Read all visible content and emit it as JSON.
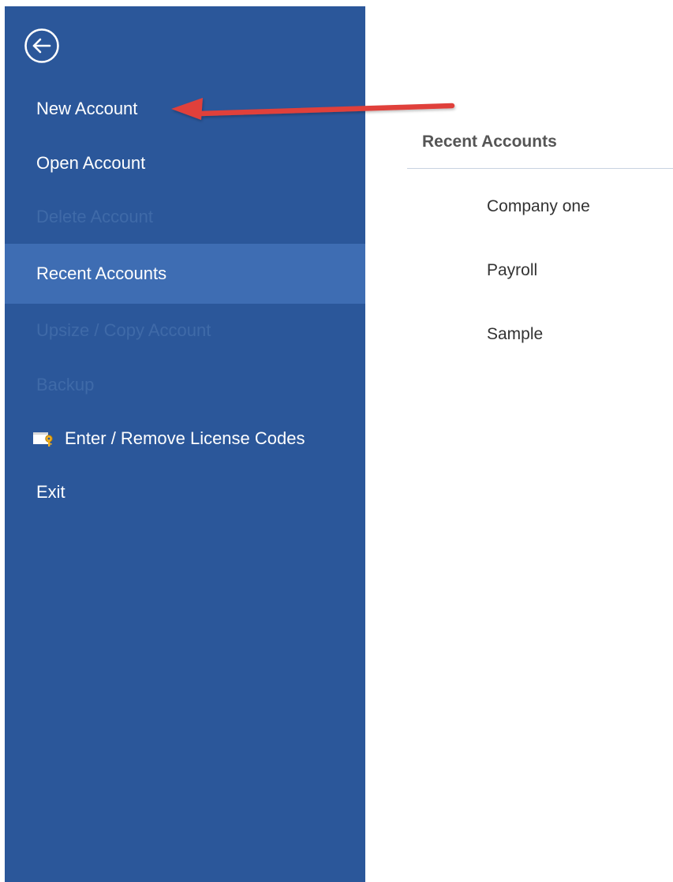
{
  "colors": {
    "sidebar_bg": "#2b579a",
    "selected_bg": "#3e6db3",
    "disabled_text": "#3f6aa8",
    "annotation_arrow": "#e0403a"
  },
  "sidebar": {
    "back_icon": "back-arrow-circle-icon",
    "items": [
      {
        "label": "New Account",
        "state": "normal"
      },
      {
        "label": "Open Account",
        "state": "normal"
      },
      {
        "label": "Delete Account",
        "state": "disabled"
      },
      {
        "label": "Recent Accounts",
        "state": "selected"
      },
      {
        "label": "Upsize / Copy Account",
        "state": "disabled"
      },
      {
        "label": "Backup",
        "state": "disabled"
      },
      {
        "label": "Enter / Remove License Codes",
        "state": "normal",
        "icon": "license-key-icon"
      },
      {
        "label": "Exit",
        "state": "normal"
      }
    ]
  },
  "recent": {
    "title": "Recent Accounts",
    "items": [
      "Company one",
      "Payroll",
      "Sample"
    ]
  },
  "annotation": {
    "icon": "red-arrow-pointing-left-icon",
    "target": "New Account"
  }
}
